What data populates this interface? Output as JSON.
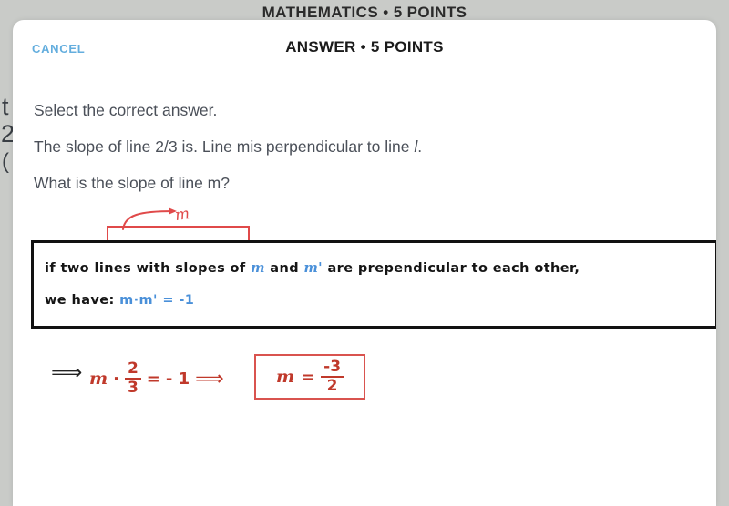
{
  "background": {
    "header_title": "MATHEMATICS • 5 POINTS",
    "fragment_1": "t",
    "fragment_2": "2",
    "fragment_3": "("
  },
  "modal": {
    "cancel_label": "CANCEL",
    "title": "ANSWER • 5 POINTS",
    "question": {
      "instruction": "Select the correct answer.",
      "statement": "The slope of line 2/3 is. Line mis perpendicular to line ",
      "statement_line_var": "l",
      "statement_end": ".",
      "question_prefix": "What is ",
      "question_highlighted": "the slope of line m",
      "question_suffix": "?"
    },
    "annotation": {
      "arrow_label": "m",
      "accent_color": "#e04a4a"
    },
    "rule_box": {
      "line1_part1": "if two lines with slopes of ",
      "line1_var1": "m",
      "line1_part2": " and ",
      "line1_var2": "m'",
      "line1_part3": " are prependicular to each other,",
      "line2_label": "we have: ",
      "line2_equation": "m·m' = -1",
      "ink_color": "#151515",
      "variable_color": "#4a90d9"
    },
    "solution": {
      "implies_1": "⟹",
      "variable": "m",
      "dot": "·",
      "fraction_numerator": "2",
      "fraction_denominator": "3",
      "equals": "=",
      "rhs": "- 1",
      "implies_2": "⟹",
      "answer_variable": "m",
      "answer_equals": "=",
      "answer_numerator": "-3",
      "answer_denominator": "2",
      "ink_color": "#c0392b"
    }
  }
}
